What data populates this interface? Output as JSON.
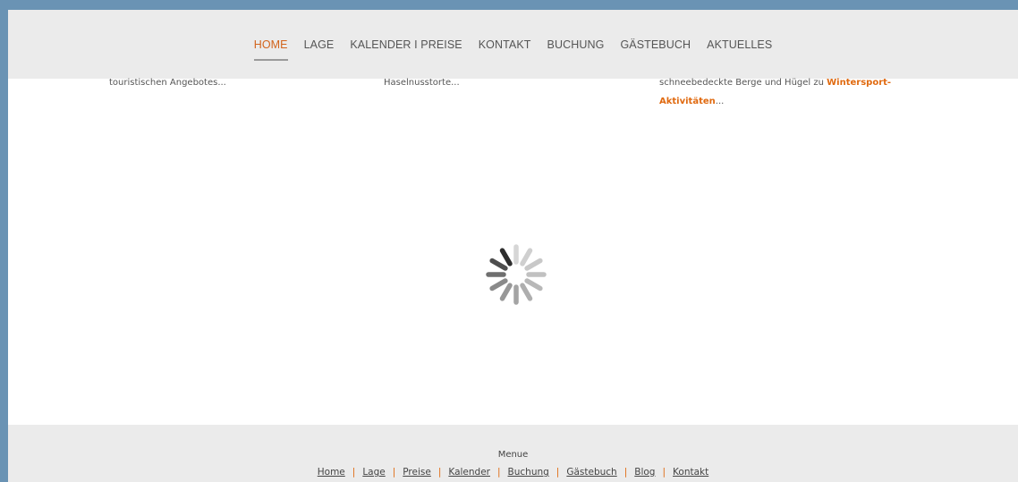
{
  "nav": {
    "items": [
      {
        "label": "HOME",
        "active": true
      },
      {
        "label": "LAGE"
      },
      {
        "label": "KALENDER I PREISE"
      },
      {
        "label": "KONTAKT"
      },
      {
        "label": "BUCHUNG"
      },
      {
        "label": "GÄSTEBUCH"
      },
      {
        "label": "AKTUELLES"
      }
    ]
  },
  "teasers": {
    "col1": "touristischen Angebotes...",
    "col2": "Haselnusstorte...",
    "col3_line1": "schneebedeckte Berge und Hügel zu ",
    "col3_link1": "Wintersport-",
    "col3_link2": "Aktivitäten",
    "col3_tail": "..."
  },
  "loading_icon": "spinner-icon",
  "footer": {
    "title": "Menue",
    "links": [
      "Home",
      "Lage",
      "Preise",
      "Kalender",
      "Buchung",
      "Gästebuch",
      "Blog",
      "Kontakt"
    ],
    "separator": "|"
  },
  "colors": {
    "accent": "#e06a10",
    "frame": "#6a93b4",
    "bar": "#ebebeb"
  }
}
